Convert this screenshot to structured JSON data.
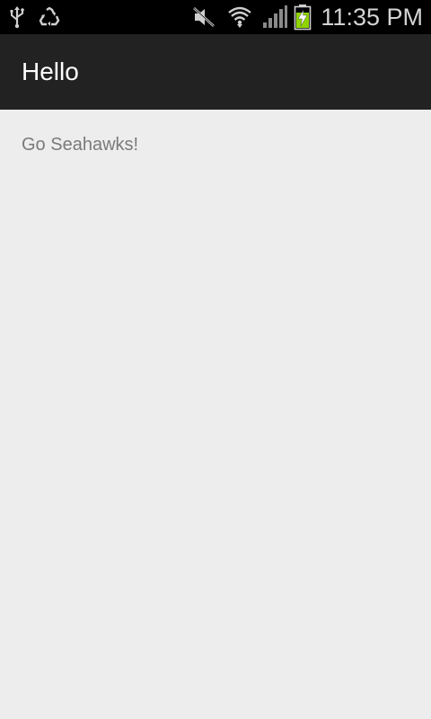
{
  "status_bar": {
    "time": "11:35 PM",
    "icons": [
      "usb-icon",
      "recycle-icon",
      "mute-icon",
      "wifi-icon",
      "signal-icon",
      "battery-charging-icon"
    ],
    "battery_color": "#8fd400"
  },
  "action_bar": {
    "title": "Hello"
  },
  "content": {
    "message": "Go Seahawks!"
  }
}
